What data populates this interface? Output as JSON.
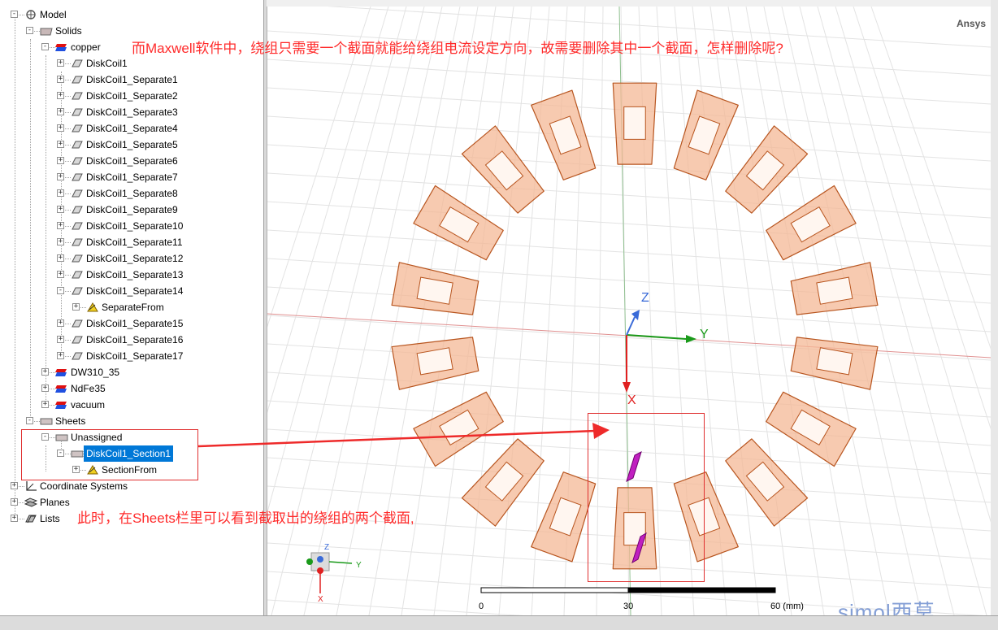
{
  "app": {
    "brand": "Ansys",
    "watermark": "simol西莫"
  },
  "tree": [
    {
      "id": "model",
      "label": "Model",
      "depth": 0,
      "toggle": "-",
      "icon": "model-icon"
    },
    {
      "id": "solids",
      "label": "Solids",
      "depth": 1,
      "toggle": "-",
      "icon": "folder-icon"
    },
    {
      "id": "copper",
      "label": "copper",
      "depth": 2,
      "toggle": "-",
      "icon": "material-icon"
    },
    {
      "id": "diskcoil1",
      "label": "DiskCoil1",
      "depth": 3,
      "toggle": "+",
      "icon": "solid-icon"
    },
    {
      "id": "sep1",
      "label": "DiskCoil1_Separate1",
      "depth": 3,
      "toggle": "+",
      "icon": "solid-icon"
    },
    {
      "id": "sep2",
      "label": "DiskCoil1_Separate2",
      "depth": 3,
      "toggle": "+",
      "icon": "solid-icon"
    },
    {
      "id": "sep3",
      "label": "DiskCoil1_Separate3",
      "depth": 3,
      "toggle": "+",
      "icon": "solid-icon"
    },
    {
      "id": "sep4",
      "label": "DiskCoil1_Separate4",
      "depth": 3,
      "toggle": "+",
      "icon": "solid-icon"
    },
    {
      "id": "sep5",
      "label": "DiskCoil1_Separate5",
      "depth": 3,
      "toggle": "+",
      "icon": "solid-icon"
    },
    {
      "id": "sep6",
      "label": "DiskCoil1_Separate6",
      "depth": 3,
      "toggle": "+",
      "icon": "solid-icon"
    },
    {
      "id": "sep7",
      "label": "DiskCoil1_Separate7",
      "depth": 3,
      "toggle": "+",
      "icon": "solid-icon"
    },
    {
      "id": "sep8",
      "label": "DiskCoil1_Separate8",
      "depth": 3,
      "toggle": "+",
      "icon": "solid-icon"
    },
    {
      "id": "sep9",
      "label": "DiskCoil1_Separate9",
      "depth": 3,
      "toggle": "+",
      "icon": "solid-icon"
    },
    {
      "id": "sep10",
      "label": "DiskCoil1_Separate10",
      "depth": 3,
      "toggle": "+",
      "icon": "solid-icon"
    },
    {
      "id": "sep11",
      "label": "DiskCoil1_Separate11",
      "depth": 3,
      "toggle": "+",
      "icon": "solid-icon"
    },
    {
      "id": "sep12",
      "label": "DiskCoil1_Separate12",
      "depth": 3,
      "toggle": "+",
      "icon": "solid-icon"
    },
    {
      "id": "sep13",
      "label": "DiskCoil1_Separate13",
      "depth": 3,
      "toggle": "+",
      "icon": "solid-icon"
    },
    {
      "id": "sep14",
      "label": "DiskCoil1_Separate14",
      "depth": 3,
      "toggle": "-",
      "icon": "solid-icon"
    },
    {
      "id": "sepfrom",
      "label": "SeparateFrom",
      "depth": 4,
      "toggle": "+",
      "icon": "operation-icon"
    },
    {
      "id": "sep15",
      "label": "DiskCoil1_Separate15",
      "depth": 3,
      "toggle": "+",
      "icon": "solid-icon"
    },
    {
      "id": "sep16",
      "label": "DiskCoil1_Separate16",
      "depth": 3,
      "toggle": "+",
      "icon": "solid-icon"
    },
    {
      "id": "sep17",
      "label": "DiskCoil1_Separate17",
      "depth": 3,
      "toggle": "+",
      "icon": "solid-icon"
    },
    {
      "id": "dw310",
      "label": "DW310_35",
      "depth": 2,
      "toggle": "+",
      "icon": "material-icon"
    },
    {
      "id": "ndfe35",
      "label": "NdFe35",
      "depth": 2,
      "toggle": "+",
      "icon": "material-icon"
    },
    {
      "id": "vacuum",
      "label": "vacuum",
      "depth": 2,
      "toggle": "+",
      "icon": "material-icon"
    },
    {
      "id": "sheets",
      "label": "Sheets",
      "depth": 1,
      "toggle": "-",
      "icon": "sheet-icon"
    },
    {
      "id": "unassigned",
      "label": "Unassigned",
      "depth": 2,
      "toggle": "-",
      "icon": "sheet-icon"
    },
    {
      "id": "section1",
      "label": "DiskCoil1_Section1",
      "depth": 3,
      "toggle": "-",
      "icon": "sheet-icon",
      "selected": true
    },
    {
      "id": "sectionfrom",
      "label": "SectionFrom",
      "depth": 4,
      "toggle": "+",
      "icon": "operation-icon"
    },
    {
      "id": "coordsys",
      "label": "Coordinate Systems",
      "depth": 0,
      "toggle": "+",
      "icon": "coordinate-icon"
    },
    {
      "id": "planes",
      "label": "Planes",
      "depth": 0,
      "toggle": "+",
      "icon": "planes-icon"
    },
    {
      "id": "lists",
      "label": "Lists",
      "depth": 0,
      "toggle": "+",
      "icon": "lists-icon"
    }
  ],
  "annotations": {
    "top": "而Maxwell软件中，绕组只需要一个截面就能给绕组电流设定方向，故需要删除其中一个截面，怎样删除呢?",
    "bottom": "此时，在Sheets栏里可以看到截取出的绕组的两个截面,"
  },
  "viewport": {
    "axis_x": "X",
    "axis_y": "Y",
    "axis_z": "Z",
    "mini_x": "X",
    "mini_y": "Y",
    "mini_z": "Z",
    "scale_labels": [
      "0",
      "30",
      "60 (mm)"
    ],
    "coil_count": 18,
    "colors": {
      "coil_fill": "#f4b896",
      "coil_stroke": "#b8551f",
      "section": "#c020c0",
      "annotation": "#ff2a2a"
    }
  }
}
